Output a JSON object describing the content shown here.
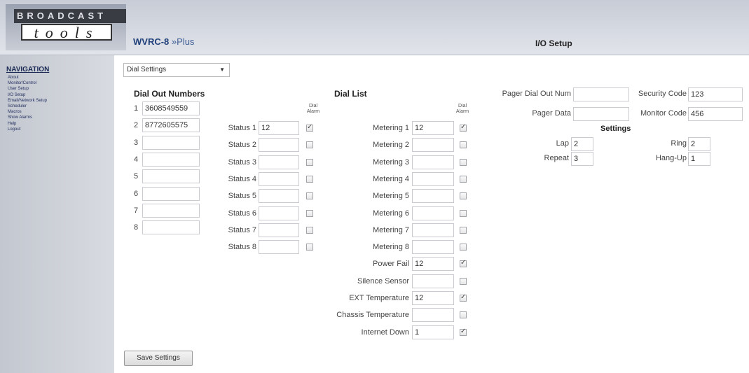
{
  "header": {
    "logo_top": "BROADCAST",
    "logo_bottom": "tools",
    "model": "WVRC-8",
    "model_suffix": "»Plus",
    "page_title": "I/O Setup"
  },
  "nav": {
    "title": "NAVIGATION",
    "items": [
      "About",
      "Monitor/Control",
      "User Setup",
      "I/O Setup",
      "Email/Network Setup",
      "Scheduler",
      "Macros",
      "Show Alarms",
      "Help",
      "Logout"
    ]
  },
  "dropdown": {
    "selected": "Dial Settings"
  },
  "dial_out": {
    "title": "Dial Out Numbers",
    "rows": [
      {
        "n": "1",
        "value": "3608549559"
      },
      {
        "n": "2",
        "value": "8772605575"
      },
      {
        "n": "3",
        "value": ""
      },
      {
        "n": "4",
        "value": ""
      },
      {
        "n": "5",
        "value": ""
      },
      {
        "n": "6",
        "value": ""
      },
      {
        "n": "7",
        "value": ""
      },
      {
        "n": "8",
        "value": ""
      }
    ]
  },
  "dial_list": {
    "title": "Dial List",
    "alarm_header": "Dial Alarm",
    "status_rows": [
      {
        "label": "Status 1",
        "value": "12",
        "checked": true
      },
      {
        "label": "Status 2",
        "value": "",
        "checked": false
      },
      {
        "label": "Status 3",
        "value": "",
        "checked": false
      },
      {
        "label": "Status 4",
        "value": "",
        "checked": false
      },
      {
        "label": "Status 5",
        "value": "",
        "checked": false
      },
      {
        "label": "Status 6",
        "value": "",
        "checked": false
      },
      {
        "label": "Status 7",
        "value": "",
        "checked": false
      },
      {
        "label": "Status 8",
        "value": "",
        "checked": false
      }
    ],
    "metering_rows": [
      {
        "label": "Metering 1",
        "value": "12",
        "checked": true
      },
      {
        "label": "Metering 2",
        "value": "",
        "checked": false
      },
      {
        "label": "Metering 3",
        "value": "",
        "checked": false
      },
      {
        "label": "Metering 4",
        "value": "",
        "checked": false
      },
      {
        "label": "Metering 5",
        "value": "",
        "checked": false
      },
      {
        "label": "Metering 6",
        "value": "",
        "checked": false
      },
      {
        "label": "Metering 7",
        "value": "",
        "checked": false
      },
      {
        "label": "Metering 8",
        "value": "",
        "checked": false
      },
      {
        "label": "Power Fail",
        "value": "12",
        "checked": true
      },
      {
        "label": "Silence Sensor",
        "value": "",
        "checked": false
      },
      {
        "label": "EXT Temperature",
        "value": "12",
        "checked": true
      },
      {
        "label": "Chassis Temperature",
        "value": "",
        "checked": false
      },
      {
        "label": "Internet Down",
        "value": "1",
        "checked": true
      }
    ]
  },
  "pager": {
    "dial_out_label": "Pager Dial Out Num",
    "dial_out_value": "",
    "data_label": "Pager Data",
    "data_value": "",
    "security_label": "Security Code",
    "security_value": "123",
    "monitor_label": "Monitor Code",
    "monitor_value": "456"
  },
  "settings": {
    "title": "Settings",
    "lap_label": "Lap",
    "lap_value": "2",
    "ring_label": "Ring",
    "ring_value": "2",
    "repeat_label": "Repeat",
    "repeat_value": "3",
    "hangup_label": "Hang-Up",
    "hangup_value": "1"
  },
  "save_button": "Save Settings"
}
